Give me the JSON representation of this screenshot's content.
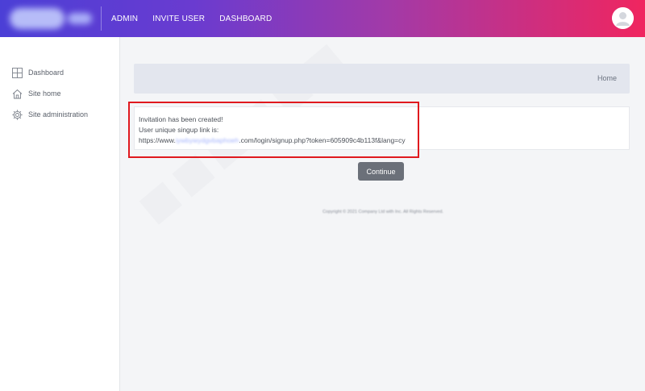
{
  "topbar": {
    "nav": [
      "ADMIN",
      "INVITE USER",
      "DASHBOARD"
    ]
  },
  "sidebar": {
    "items": [
      {
        "label": "Dashboard",
        "icon": "dashboard-icon"
      },
      {
        "label": "Site home",
        "icon": "home-icon"
      },
      {
        "label": "Site administration",
        "icon": "gear-icon"
      }
    ]
  },
  "main": {
    "breadcrumb": "Home",
    "message": {
      "line1": "Invitation has been created!",
      "line2": "User unique singup link is:",
      "url_prefix": "https://www.",
      "url_domain": "iywbywydgvbaphoeh",
      "url_suffix": ".com/login/signup.php?token=605909c4b113f&lang=cy"
    },
    "continue_label": "Continue",
    "footer": "Copyright © 2021 Company Ltd with Inc. All Rights Reserved."
  },
  "colors": {
    "gradient_start": "#4b3fd6",
    "gradient_end": "#f0255f",
    "highlight_border": "#e0191e",
    "button": "#6b7079"
  }
}
